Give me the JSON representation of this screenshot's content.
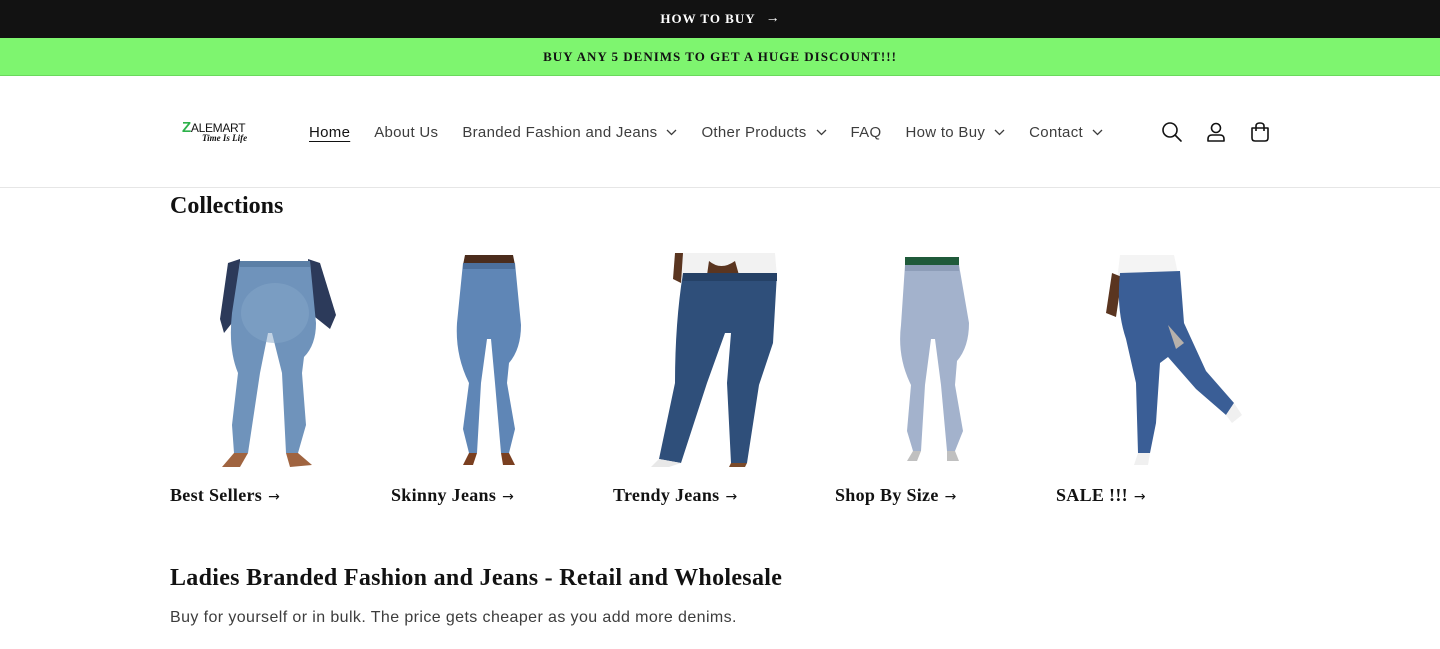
{
  "announcement": {
    "label": "HOW TO BUY",
    "arrow": "→"
  },
  "promo_bar": {
    "text": "BUY ANY 5 DENIMS TO GET A HUGE DISCOUNT!!!",
    "color": "#7ef56f"
  },
  "logo": {
    "main": "ALEMART",
    "z": "Z",
    "tagline": "Time Is Life",
    "icon": "zalemart-logo"
  },
  "nav": {
    "items": [
      {
        "label": "Home",
        "active": true
      },
      {
        "label": "About Us"
      },
      {
        "label": "Branded Fashion and Jeans",
        "dropdown": true
      },
      {
        "label": "Other Products",
        "dropdown": true
      },
      {
        "label": "FAQ"
      },
      {
        "label": "How to Buy",
        "dropdown": true
      },
      {
        "label": "Contact",
        "dropdown": true
      }
    ]
  },
  "header_icons": [
    "search-icon",
    "account-icon",
    "cart-icon"
  ],
  "collections": {
    "title": "Collections",
    "items": [
      {
        "label": "Best Sellers",
        "arrow": "→"
      },
      {
        "label": "Skinny Jeans",
        "arrow": "→"
      },
      {
        "label": "Trendy Jeans",
        "arrow": "→"
      },
      {
        "label": "Shop By Size",
        "arrow": "→"
      },
      {
        "label": "SALE !!!",
        "arrow": "→"
      }
    ]
  },
  "intro": {
    "heading": "Ladies Branded Fashion and Jeans - Retail and Wholesale",
    "text": "Buy for yourself or in bulk. The price gets cheaper as you add more denims."
  }
}
